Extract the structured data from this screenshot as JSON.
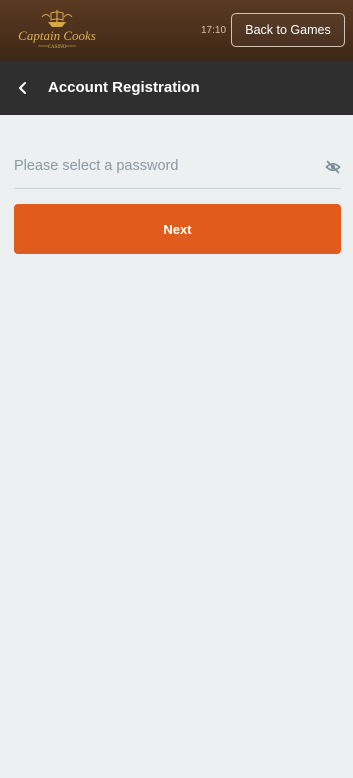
{
  "header": {
    "brand": "Captain Cooks Casino",
    "time": "17:10",
    "back_label": "Back to Games",
    "background_color": "#4a301c"
  },
  "page": {
    "title": "Account Registration",
    "back_icon": "chevron-left-icon"
  },
  "form": {
    "password_placeholder": "Please select a password",
    "password_value": "",
    "visibility_icon": "eye-off-icon",
    "next_label": "Next",
    "accent_color": "#e05b1c"
  }
}
